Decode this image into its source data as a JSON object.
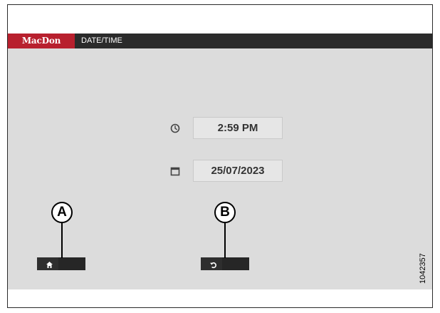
{
  "header": {
    "logo_text": "MacDon",
    "title": "DATE/TIME"
  },
  "time": {
    "icon": "clock-icon",
    "value": "2:59 PM"
  },
  "date": {
    "icon": "calendar-icon",
    "value": "25/07/2023"
  },
  "buttons": {
    "home_icon": "home-icon",
    "back_icon": "back-icon"
  },
  "callouts": {
    "a": "A",
    "b": "B"
  },
  "figure_number": "1042357",
  "colors": {
    "brand_red": "#b8202e",
    "header_bg": "#2b2b2b",
    "screen_bg": "#dcdcdc"
  }
}
